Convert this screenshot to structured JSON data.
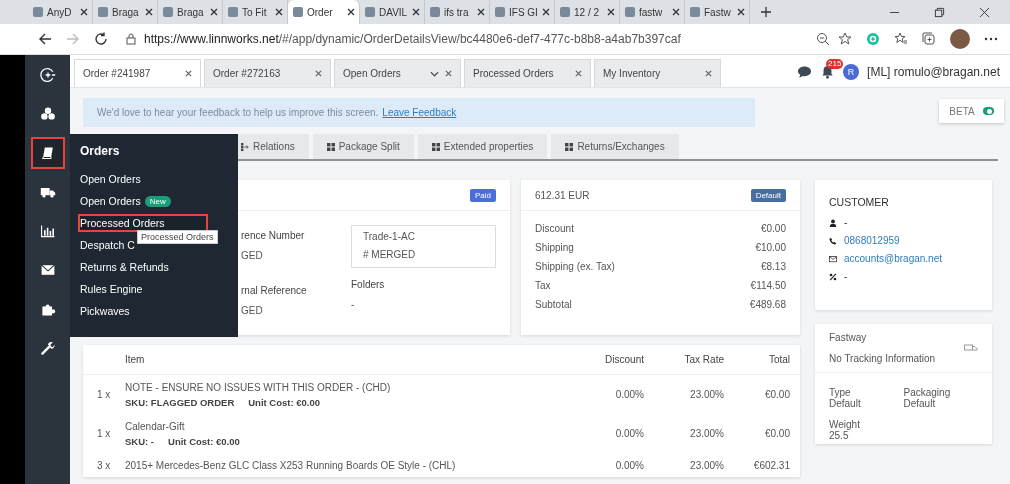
{
  "browser": {
    "tabs": [
      {
        "label": "AnyD",
        "selected": false
      },
      {
        "label": "Braga",
        "selected": false
      },
      {
        "label": "Braga",
        "selected": false
      },
      {
        "label": "To Fit",
        "selected": false
      },
      {
        "label": "Order",
        "selected": true
      },
      {
        "label": "DAVIL",
        "selected": false
      },
      {
        "label": "ifs tra",
        "selected": false
      },
      {
        "label": "IFS GI",
        "selected": false
      },
      {
        "label": "12 / 2",
        "selected": false
      },
      {
        "label": "fastw",
        "selected": false
      },
      {
        "label": "Fastw",
        "selected": false
      }
    ],
    "url_host": "https://www.linnworks.net",
    "url_path": "/#/app/dynamic/OrderDetailsView/bc4480e6-def7-477c-b8b8-a4ab7b397caf"
  },
  "sidebar": {
    "items": [
      {
        "kind": "logo",
        "selected": false
      },
      {
        "kind": "cubes",
        "selected": false
      },
      {
        "kind": "book",
        "selected": true
      },
      {
        "kind": "truck",
        "selected": false
      },
      {
        "kind": "chart",
        "selected": false
      },
      {
        "kind": "mail",
        "selected": false
      },
      {
        "kind": "puzzle",
        "selected": false
      },
      {
        "kind": "wrench",
        "selected": false
      }
    ]
  },
  "app_tabs": [
    {
      "label": "Order #241987",
      "selected": true,
      "dropdown": false
    },
    {
      "label": "Order #272163",
      "selected": false,
      "dropdown": false
    },
    {
      "label": "Open Orders",
      "selected": false,
      "dropdown": true
    },
    {
      "label": "Processed Orders",
      "selected": false,
      "dropdown": false
    },
    {
      "label": "My Inventory",
      "selected": false,
      "dropdown": false
    }
  ],
  "header": {
    "notification_count": "215",
    "avatar_initial": "R",
    "user": "[ML] romulo@bragan.net"
  },
  "feedback": {
    "text": "We'd love to hear your feedback to help us improve this screen.",
    "link": "Leave Feedback"
  },
  "beta": {
    "label": "BETA",
    "on": true
  },
  "detail_tabs": [
    "Relations",
    "Package Split",
    "Extended properties",
    "Returns/Exchanges"
  ],
  "menu": {
    "title": "Orders",
    "tooltip": "Processed Orders",
    "items": [
      {
        "label": "Open Orders",
        "selected": false
      },
      {
        "label": "Open Orders",
        "badge": "New",
        "selected": false
      },
      {
        "label": "Processed Orders",
        "selected": true
      },
      {
        "label": "Despatch C",
        "selected": false
      },
      {
        "label": "Returns & Refunds",
        "selected": false
      },
      {
        "label": "Rules Engine",
        "selected": false
      },
      {
        "label": "Pickwaves",
        "selected": false
      }
    ]
  },
  "order_card": {
    "badge": "Paid",
    "fields": [
      {
        "label": "rence Number",
        "value": "GED"
      },
      {
        "label": "rnal Reference",
        "value": "GED"
      }
    ],
    "source": {
      "title": "Trade-1-AC",
      "value": "# MERGED"
    },
    "folders": {
      "label": "Folders",
      "value": "-"
    }
  },
  "totals": {
    "amount": "612.31 EUR",
    "badge": "Default",
    "rows": [
      {
        "label": "Discount",
        "value": "€0.00"
      },
      {
        "label": "Shipping",
        "value": "€10.00"
      },
      {
        "label": "Shipping (ex. Tax)",
        "value": "€8.13"
      },
      {
        "label": "Tax",
        "value": "€114.50"
      },
      {
        "label": "Subtotal",
        "value": "€489.68"
      }
    ]
  },
  "customer": {
    "title": "CUSTOMER",
    "rows": [
      {
        "kind": "person",
        "text": "-",
        "link": false
      },
      {
        "kind": "phone",
        "text": "0868012959",
        "link": true
      },
      {
        "kind": "email",
        "text": "accounts@bragan.net",
        "link": true
      },
      {
        "kind": "percent",
        "text": "-",
        "link": false
      }
    ]
  },
  "shipping": {
    "carrier": "Fastway",
    "tracking": "No Tracking Information",
    "fields": [
      {
        "label": "Type",
        "value": "Default"
      },
      {
        "label": "Packaging",
        "value": "Default"
      },
      {
        "label": "Weight",
        "value": "25.5"
      }
    ]
  },
  "items": {
    "columns": [
      "Item",
      "Discount",
      "Tax Rate",
      "Total"
    ],
    "rows": [
      {
        "qty": "1 x",
        "name": "NOTE - ENSURE NO ISSUES WITH THIS ORDER - (CHD)",
        "sku": "SKU: FLAGGED ORDER",
        "unit_cost": "Unit Cost: €0.00",
        "discount": "0.00%",
        "tax_rate": "23.00%",
        "total": "€0.00"
      },
      {
        "qty": "1 x",
        "name": "Calendar-Gift",
        "sku": "SKU: -",
        "unit_cost": "Unit Cost: €0.00",
        "discount": "0.00%",
        "tax_rate": "23.00%",
        "total": "€0.00"
      },
      {
        "qty": "3 x",
        "name": "2015+ Mercedes-Benz GLC Class X253 Running Boards OE Style - (CHL)",
        "discount": "0.00%",
        "tax_rate": "23.00%",
        "total": "€602.31"
      }
    ]
  }
}
